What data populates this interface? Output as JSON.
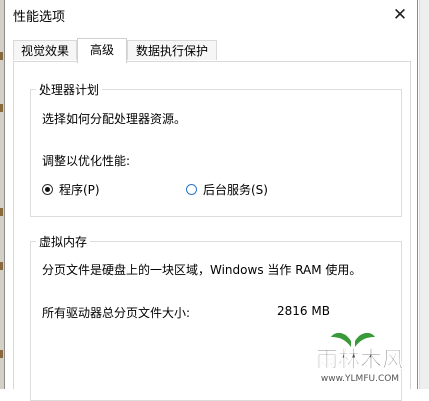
{
  "window": {
    "title": "性能选项",
    "close_glyph": "✕"
  },
  "tabs": [
    {
      "label": "视觉效果",
      "active": false
    },
    {
      "label": "高级",
      "active": true
    },
    {
      "label": "数据执行保护",
      "active": false
    }
  ],
  "processor_group": {
    "title": "处理器计划",
    "description": "选择如何分配处理器资源。",
    "adjust_label": "调整以优化性能:",
    "options": [
      {
        "label": "程序(P)",
        "selected": true
      },
      {
        "label": "后台服务(S)",
        "selected": false
      }
    ]
  },
  "virtual_memory_group": {
    "title": "虚拟内存",
    "description": "分页文件是硬盘上的一块区域，Windows 当作 RAM 使用。",
    "total_label": "所有驱动器总分页文件大小:",
    "total_value": "2816 MB"
  },
  "watermark": {
    "brand": "雨林木风",
    "url": "www.YLMFU.COM"
  },
  "colors": {
    "radio_accent": "#2a78c6",
    "watermark_green": "#3a9a3a"
  }
}
